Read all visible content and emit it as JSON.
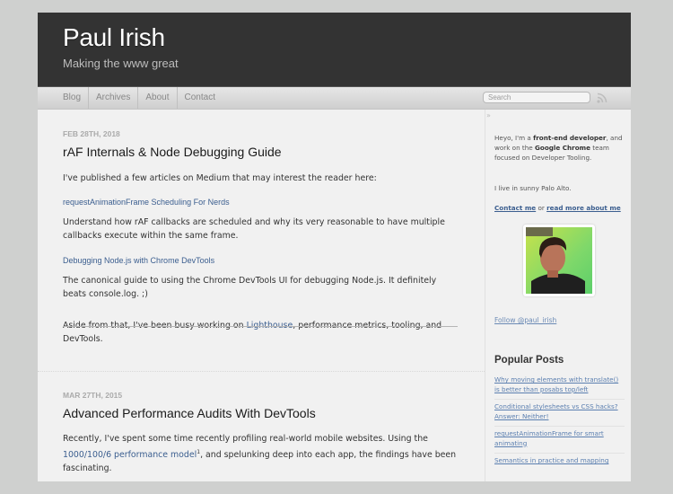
{
  "site": {
    "title": "Paul Irish",
    "subtitle": "Making the www great"
  },
  "nav": {
    "items": [
      {
        "label": "Blog"
      },
      {
        "label": "Archives"
      },
      {
        "label": "About"
      },
      {
        "label": "Contact"
      }
    ],
    "search_placeholder": "Search",
    "rss_icon": "rss-feed-icon"
  },
  "posts": [
    {
      "date": "FEB 28TH, 2018",
      "title": "rAF Internals & Node Debugging Guide",
      "intro": "I've published a few articles on Medium that may interest the reader here:",
      "link1": "requestAnimationFrame Scheduling For Nerds",
      "link1_desc": "Understand how rAF callbacks are scheduled and why its very reasonable to have multiple callbacks execute within the same frame.",
      "link2": "Debugging Node.js with Chrome DevTools",
      "link2_desc": "The canonical guide to using the Chrome DevTools UI for debugging Node.js. It definitely beats console.log. ;)",
      "aside_before": "Aside from that, I've been busy working on ",
      "aside_link": "Lighthouse",
      "aside_after": ", performance metrics, tooling, and DevTools."
    },
    {
      "date": "MAR 27TH, 2015",
      "title": "Advanced Performance Audits With DevTools",
      "text_before": "Recently, I've spent some time recently profiling real-world mobile websites. Using the ",
      "link": "1000/100/6 performance model",
      "footnote": "1",
      "text_after": ", and spelunking deep into each app, the findings have been fascinating."
    }
  ],
  "sidebar": {
    "toggle": "»",
    "bio_1": "Heyo, I'm a ",
    "bio_bold_1": "front-end developer",
    "bio_2": ", and work on the ",
    "bio_bold_2": "Google Chrome",
    "bio_3": " team focused on Developer Tooling.",
    "location": "I live in sunny Palo Alto.",
    "contact_link": "Contact me",
    "or": " or ",
    "about_link": "read more about me",
    "follow": "Follow @paul_irish",
    "popular_title": "Popular Posts",
    "popular": [
      {
        "label": "Why moving elements with translate() is better than posabs top/left"
      },
      {
        "label": "Conditional stylesheets vs CSS hacks? Answer: Neither!"
      },
      {
        "label": "requestAnimationFrame for smart animating"
      },
      {
        "label": "Semantics in practice and mapping"
      }
    ]
  },
  "colors": {
    "header_bg": "#333333",
    "link": "#3b5e8f",
    "page_bg": "#f1f1f1",
    "outer_bg": "#cfd0cf"
  }
}
